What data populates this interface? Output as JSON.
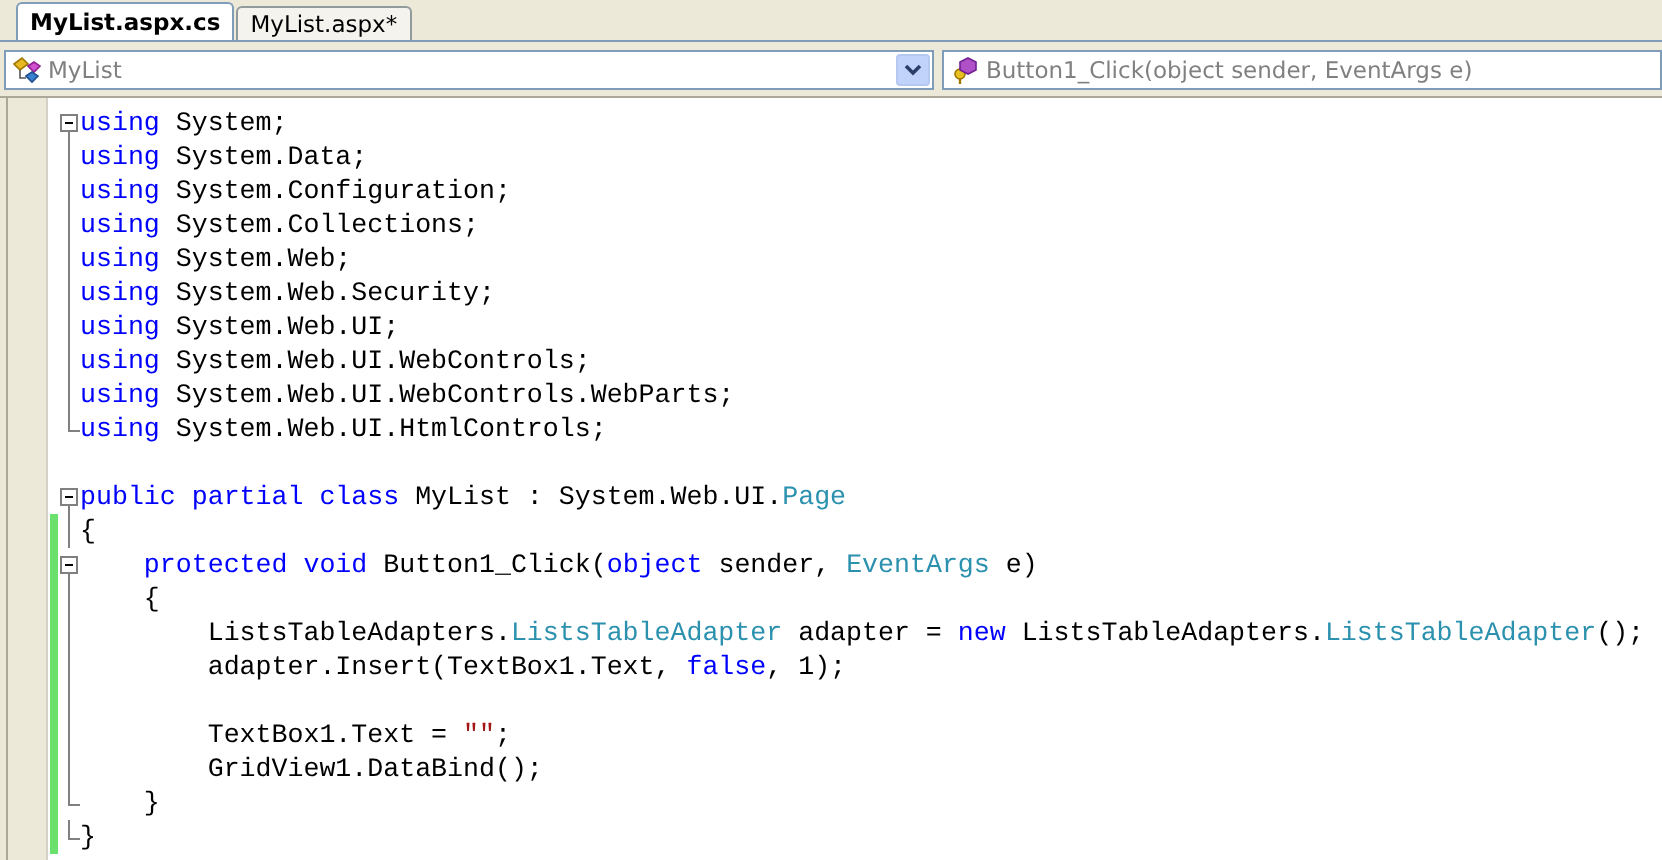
{
  "tabs": [
    {
      "label": "MyList.aspx.cs",
      "selected": true
    },
    {
      "label": "MyList.aspx*",
      "selected": false
    }
  ],
  "navigation": {
    "type_combo": "MyList",
    "member_combo": "Button1_Click(object sender, EventArgs e)"
  },
  "code_lines": [
    {
      "kind": "region-start",
      "changed": false,
      "tokens": [
        {
          "kind": "keyword",
          "text": "using"
        },
        {
          "kind": "plain",
          "text": " System;"
        }
      ]
    },
    {
      "kind": "region-body",
      "changed": false,
      "tokens": [
        {
          "kind": "keyword",
          "text": "using"
        },
        {
          "kind": "plain",
          "text": " System.Data;"
        }
      ]
    },
    {
      "kind": "region-body",
      "changed": false,
      "tokens": [
        {
          "kind": "keyword",
          "text": "using"
        },
        {
          "kind": "plain",
          "text": " System.Configuration;"
        }
      ]
    },
    {
      "kind": "region-body",
      "changed": false,
      "tokens": [
        {
          "kind": "keyword",
          "text": "using"
        },
        {
          "kind": "plain",
          "text": " System.Collections;"
        }
      ]
    },
    {
      "kind": "region-body",
      "changed": false,
      "tokens": [
        {
          "kind": "keyword",
          "text": "using"
        },
        {
          "kind": "plain",
          "text": " System.Web;"
        }
      ]
    },
    {
      "kind": "region-body",
      "changed": false,
      "tokens": [
        {
          "kind": "keyword",
          "text": "using"
        },
        {
          "kind": "plain",
          "text": " System.Web.Security;"
        }
      ]
    },
    {
      "kind": "region-body",
      "changed": false,
      "tokens": [
        {
          "kind": "keyword",
          "text": "using"
        },
        {
          "kind": "plain",
          "text": " System.Web.UI;"
        }
      ]
    },
    {
      "kind": "region-body",
      "changed": false,
      "tokens": [
        {
          "kind": "keyword",
          "text": "using"
        },
        {
          "kind": "plain",
          "text": " System.Web.UI.WebControls;"
        }
      ]
    },
    {
      "kind": "region-body",
      "changed": false,
      "tokens": [
        {
          "kind": "keyword",
          "text": "using"
        },
        {
          "kind": "plain",
          "text": " System.Web.UI.WebControls.WebParts;"
        }
      ]
    },
    {
      "kind": "region-end",
      "changed": false,
      "tokens": [
        {
          "kind": "keyword",
          "text": "using"
        },
        {
          "kind": "plain",
          "text": " System.Web.UI.HtmlControls;"
        }
      ]
    },
    {
      "kind": "plain",
      "changed": false
    },
    {
      "kind": "region-start",
      "changed": false,
      "tokens": [
        {
          "kind": "keyword",
          "text": "public partial class"
        },
        {
          "kind": "plain",
          "text": " MyList : System.Web.UI."
        },
        {
          "kind": "type",
          "text": "Page"
        }
      ]
    },
    {
      "kind": "region-body",
      "changed": true,
      "tokens": [
        {
          "kind": "plain",
          "text": "{"
        }
      ]
    },
    {
      "kind": "region-start",
      "changed": true,
      "tokens": [
        {
          "kind": "keyword",
          "text": "    protected void"
        },
        {
          "kind": "plain",
          "text": " Button1_Click("
        },
        {
          "kind": "keyword",
          "text": "object"
        },
        {
          "kind": "plain",
          "text": " sender, "
        },
        {
          "kind": "type",
          "text": "EventArgs"
        },
        {
          "kind": "plain",
          "text": " e)"
        }
      ]
    },
    {
      "kind": "region-body",
      "changed": true,
      "tokens": [
        {
          "kind": "plain",
          "text": "    {"
        }
      ]
    },
    {
      "kind": "region-body",
      "changed": true,
      "tokens": [
        {
          "kind": "plain",
          "text": "        ListsTableAdapters."
        },
        {
          "kind": "type",
          "text": "ListsTableAdapter"
        },
        {
          "kind": "plain",
          "text": " adapter = "
        },
        {
          "kind": "keyword",
          "text": "new"
        },
        {
          "kind": "plain",
          "text": " ListsTableAdapters."
        },
        {
          "kind": "type",
          "text": "ListsTableAdapter"
        },
        {
          "kind": "plain",
          "text": "();"
        }
      ]
    },
    {
      "kind": "region-body",
      "changed": true,
      "tokens": [
        {
          "kind": "plain",
          "text": "        adapter.Insert(TextBox1.Text, "
        },
        {
          "kind": "keyword",
          "text": "false"
        },
        {
          "kind": "plain",
          "text": ", 1);"
        }
      ]
    },
    {
      "kind": "region-body",
      "changed": true
    },
    {
      "kind": "region-body",
      "changed": true,
      "tokens": [
        {
          "kind": "plain",
          "text": "        TextBox1.Text = "
        },
        {
          "kind": "string",
          "text": "\"\""
        },
        {
          "kind": "plain",
          "text": ";"
        }
      ]
    },
    {
      "kind": "region-body",
      "changed": true,
      "tokens": [
        {
          "kind": "plain",
          "text": "        GridView1.DataBind();"
        }
      ]
    },
    {
      "kind": "region-end",
      "changed": true,
      "tokens": [
        {
          "kind": "plain",
          "text": "    }"
        }
      ]
    },
    {
      "kind": "region-end",
      "changed": true,
      "tokens": [
        {
          "kind": "plain",
          "text": "}"
        }
      ]
    }
  ]
}
